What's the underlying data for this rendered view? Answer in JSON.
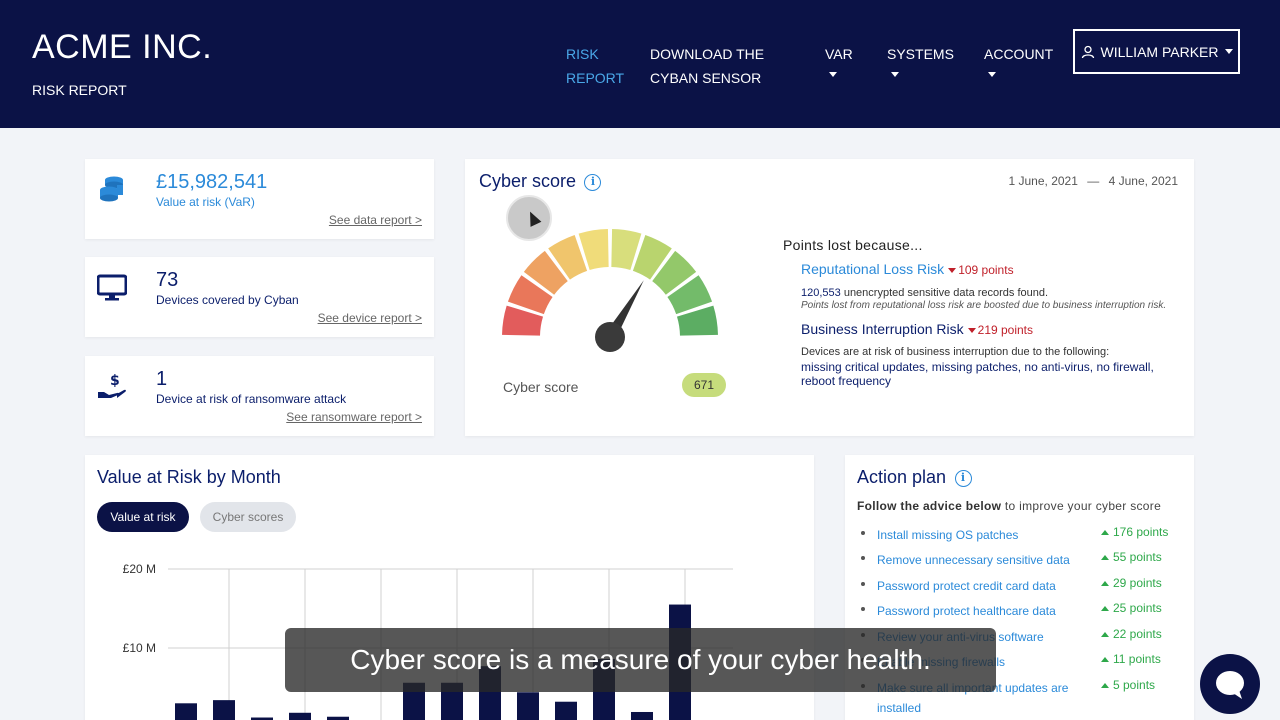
{
  "header": {
    "brand": "ACME INC.",
    "subtitle": "RISK REPORT",
    "nav": {
      "risk_report_line1": "RISK",
      "risk_report_line2": "REPORT",
      "download_line1": "DOWNLOAD THE",
      "download_line2": "CYBAN SENSOR",
      "var": "VAR",
      "systems": "SYSTEMS",
      "account": "ACCOUNT"
    },
    "user": "WILLIAM PARKER"
  },
  "kpis": [
    {
      "value": "£15,982,541",
      "label": "Value at risk (VaR)",
      "link": "See data report >",
      "icon": "coins-stack-icon"
    },
    {
      "value": "73",
      "label": "Devices covered by Cyban",
      "link": "See device report >",
      "icon": "monitor-icon"
    },
    {
      "value": "1",
      "label": "Device at risk of ransomware attack",
      "link": "See ransomware report >",
      "icon": "hand-dollar-icon"
    }
  ],
  "cyber_score": {
    "title": "Cyber score",
    "date_start": "1 June, 2021",
    "date_sep": "—",
    "date_end": "4 June, 2021",
    "gauge_label": "Cyber score",
    "score": "671",
    "score_value": 671,
    "score_max": 1000,
    "points_lost_title": "Points lost because...",
    "reputational": {
      "name": "Reputational Loss Risk",
      "points": "109 points",
      "count": "120,553",
      "text": " unencrypted sensitive data records found.",
      "note": "Points lost from reputational loss risk are boosted due to business interruption risk."
    },
    "business": {
      "name": "Business Interruption Risk",
      "points": "219 points",
      "text": "Devices are at risk of business interruption due to the following:",
      "links": "missing critical updates, missing patches, no anti-virus, no firewall, reboot frequency"
    },
    "colors": [
      "#e25c5c",
      "#e9775a",
      "#eea262",
      "#f0c56c",
      "#f0dc7a",
      "#d8de7c",
      "#b9d46e",
      "#93c86a",
      "#73bb6a",
      "#5cad63"
    ]
  },
  "var_chart": {
    "title": "Value at Risk by Month",
    "toggle_on": "Value at risk",
    "toggle_off": "Cyber scores"
  },
  "chart_data": {
    "type": "bar",
    "title": "Value at Risk by Month",
    "y_ticks": [
      "£20 M",
      "£10 M"
    ],
    "ylim": [
      0,
      20
    ],
    "values": [
      3,
      3.4,
      1.2,
      1.8,
      1.3,
      0.4,
      5.6,
      5.6,
      7.7,
      4.4,
      3.2,
      8.6,
      1.9,
      15.5
    ],
    "grid": true
  },
  "action_plan": {
    "title": "Action plan",
    "subtitle_bold": "Follow the advice below",
    "subtitle_rest": " to improve your cyber score",
    "items": [
      {
        "label": "Install missing OS patches",
        "points": "176 points"
      },
      {
        "label": "Remove unnecessary sensitive data",
        "points": "55 points"
      },
      {
        "label": "Password protect credit card data",
        "points": "29 points"
      },
      {
        "label": "Password protect healthcare data",
        "points": "25 points"
      },
      {
        "label": "Review your anti-virus software",
        "points": "22 points"
      },
      {
        "label": "Enable missing firewalls",
        "points": "11 points"
      },
      {
        "label": "Make sure all important updates are installed",
        "points": "5 points"
      }
    ]
  },
  "caption": "Cyber score is a measure of your cyber health."
}
